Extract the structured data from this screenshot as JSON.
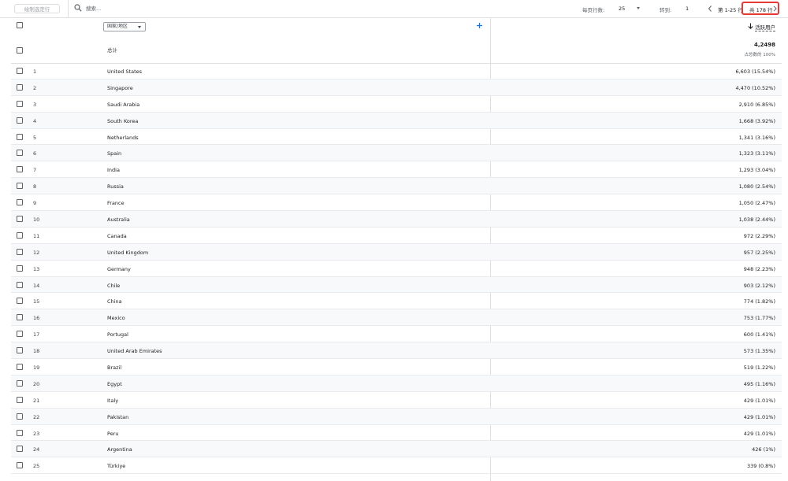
{
  "toolbar": {
    "plot_button_label": "绘制选定行",
    "search_placeholder": "搜索...",
    "rows_per_page_label": "每页行数:",
    "rows_per_page_value": "25",
    "goto_label": "转到:",
    "goto_value": "1",
    "range_text": "第 1-25 行",
    "total_text": "共 178 行"
  },
  "table": {
    "dimension_label": "国家/地区",
    "metric_label": "活跃用户",
    "totals": {
      "label": "总计",
      "value": "4,2498",
      "sub": "占总数的 100%"
    },
    "rows": [
      {
        "num": "1",
        "country": "United States",
        "value": "6,603 (15.54%)"
      },
      {
        "num": "2",
        "country": "Singapore",
        "value": "4,470 (10.52%)"
      },
      {
        "num": "3",
        "country": "Saudi Arabia",
        "value": "2,910 (6.85%)"
      },
      {
        "num": "4",
        "country": "South Korea",
        "value": "1,668 (3.92%)"
      },
      {
        "num": "5",
        "country": "Netherlands",
        "value": "1,341 (3.16%)"
      },
      {
        "num": "6",
        "country": "Spain",
        "value": "1,323 (3.11%)"
      },
      {
        "num": "7",
        "country": "India",
        "value": "1,293 (3.04%)"
      },
      {
        "num": "8",
        "country": "Russia",
        "value": "1,080 (2.54%)"
      },
      {
        "num": "9",
        "country": "France",
        "value": "1,050 (2.47%)"
      },
      {
        "num": "10",
        "country": "Australia",
        "value": "1,038 (2.44%)"
      },
      {
        "num": "11",
        "country": "Canada",
        "value": "972 (2.29%)"
      },
      {
        "num": "12",
        "country": "United Kingdom",
        "value": "957 (2.25%)"
      },
      {
        "num": "13",
        "country": "Germany",
        "value": "948 (2.23%)"
      },
      {
        "num": "14",
        "country": "Chile",
        "value": "903 (2.12%)"
      },
      {
        "num": "15",
        "country": "China",
        "value": "774 (1.82%)"
      },
      {
        "num": "16",
        "country": "Mexico",
        "value": "753 (1.77%)"
      },
      {
        "num": "17",
        "country": "Portugal",
        "value": "600 (1.41%)"
      },
      {
        "num": "18",
        "country": "United Arab Emirates",
        "value": "573 (1.35%)"
      },
      {
        "num": "19",
        "country": "Brazil",
        "value": "519 (1.22%)"
      },
      {
        "num": "20",
        "country": "Egypt",
        "value": "495 (1.16%)"
      },
      {
        "num": "21",
        "country": "Italy",
        "value": "429 (1.01%)"
      },
      {
        "num": "22",
        "country": "Pakistan",
        "value": "429 (1.01%)"
      },
      {
        "num": "23",
        "country": "Peru",
        "value": "429 (1.01%)"
      },
      {
        "num": "24",
        "country": "Argentina",
        "value": "426 (1%)"
      },
      {
        "num": "25",
        "country": "Türkiye",
        "value": "339 (0.8%)"
      }
    ]
  },
  "icons": {
    "search": "search-icon",
    "prev": "chevron-left-icon",
    "next": "chevron-right-icon",
    "add": "plus-icon",
    "sort": "arrow-down-icon"
  },
  "colors": {
    "highlight_border": "#e53935",
    "accent": "#1a73e8"
  }
}
